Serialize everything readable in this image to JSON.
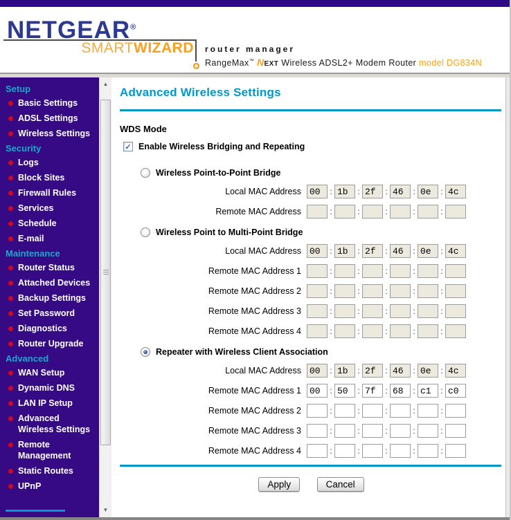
{
  "header": {
    "brand": "NETGEAR",
    "reg": "®",
    "smart": "SMART",
    "wizard": "WIZARD",
    "subtitle": "router manager",
    "product_prefix": "RangeMax",
    "tm": "™",
    "next_n": "N",
    "next_ext": "EXT",
    "product_rest": " Wireless ADSL2+ Modem Router ",
    "model": "model DG834N"
  },
  "sidebar": {
    "sections": [
      {
        "label": "Setup",
        "items": [
          "Basic Settings",
          "ADSL Settings",
          "Wireless Settings"
        ]
      },
      {
        "label": "Security",
        "items": [
          "Logs",
          "Block Sites",
          "Firewall Rules",
          "Services",
          "Schedule",
          "E-mail"
        ]
      },
      {
        "label": "Maintenance",
        "items": [
          "Router Status",
          "Attached Devices",
          "Backup Settings",
          "Set Password",
          "Diagnostics",
          "Router Upgrade"
        ]
      },
      {
        "label": "Advanced",
        "items": [
          "WAN Setup",
          "Dynamic DNS",
          "LAN IP Setup",
          "Advanced Wireless Settings",
          "Remote Management",
          "Static Routes",
          "UPnP"
        ]
      }
    ]
  },
  "main": {
    "title": "Advanced Wireless Settings",
    "wds_heading": "WDS Mode",
    "enable_label": "Enable Wireless Bridging and Repeating",
    "enable_checked": true,
    "colon": ":",
    "sections": [
      {
        "radio_label": "Wireless Point-to-Point Bridge",
        "selected": false,
        "rows": [
          {
            "label": "Local MAC Address",
            "disabled": true,
            "values": [
              "00",
              "1b",
              "2f",
              "46",
              "0e",
              "4c"
            ]
          },
          {
            "label": "Remote MAC Address",
            "disabled": true,
            "values": [
              "",
              "",
              "",
              "",
              "",
              ""
            ]
          }
        ]
      },
      {
        "radio_label": "Wireless Point to Multi-Point Bridge",
        "selected": false,
        "rows": [
          {
            "label": "Local MAC Address",
            "disabled": true,
            "values": [
              "00",
              "1b",
              "2f",
              "46",
              "0e",
              "4c"
            ]
          },
          {
            "label": "Remote MAC Address 1",
            "disabled": true,
            "values": [
              "",
              "",
              "",
              "",
              "",
              ""
            ]
          },
          {
            "label": "Remote MAC Address 2",
            "disabled": true,
            "values": [
              "",
              "",
              "",
              "",
              "",
              ""
            ]
          },
          {
            "label": "Remote MAC Address 3",
            "disabled": true,
            "values": [
              "",
              "",
              "",
              "",
              "",
              ""
            ]
          },
          {
            "label": "Remote MAC Address 4",
            "disabled": true,
            "values": [
              "",
              "",
              "",
              "",
              "",
              ""
            ]
          }
        ]
      },
      {
        "radio_label": "Repeater with Wireless Client Association",
        "selected": true,
        "rows": [
          {
            "label": "Local MAC Address",
            "disabled": true,
            "values": [
              "00",
              "1b",
              "2f",
              "46",
              "0e",
              "4c"
            ]
          },
          {
            "label": "Remote MAC Address 1",
            "disabled": false,
            "values": [
              "00",
              "50",
              "7f",
              "68",
              "c1",
              "c0"
            ]
          },
          {
            "label": "Remote MAC Address 2",
            "disabled": false,
            "values": [
              "",
              "",
              "",
              "",
              "",
              ""
            ]
          },
          {
            "label": "Remote MAC Address 3",
            "disabled": false,
            "values": [
              "",
              "",
              "",
              "",
              "",
              ""
            ]
          },
          {
            "label": "Remote MAC Address 4",
            "disabled": false,
            "values": [
              "",
              "",
              "",
              "",
              "",
              ""
            ]
          }
        ]
      }
    ],
    "apply_label": "Apply",
    "cancel_label": "Cancel"
  },
  "icons": {
    "scroll_up": "▲",
    "scroll_down": "▼",
    "check": "✓"
  },
  "colors": {
    "brand_blue": "#2b3990",
    "brand_orange": "#f6a01d",
    "sidebar_purple": "#350a84",
    "section_cyan": "#1ba9cc",
    "bullet_red": "#c80a28",
    "accent_blue": "#0098c8",
    "disabled_field_bg": "#eceadf"
  }
}
